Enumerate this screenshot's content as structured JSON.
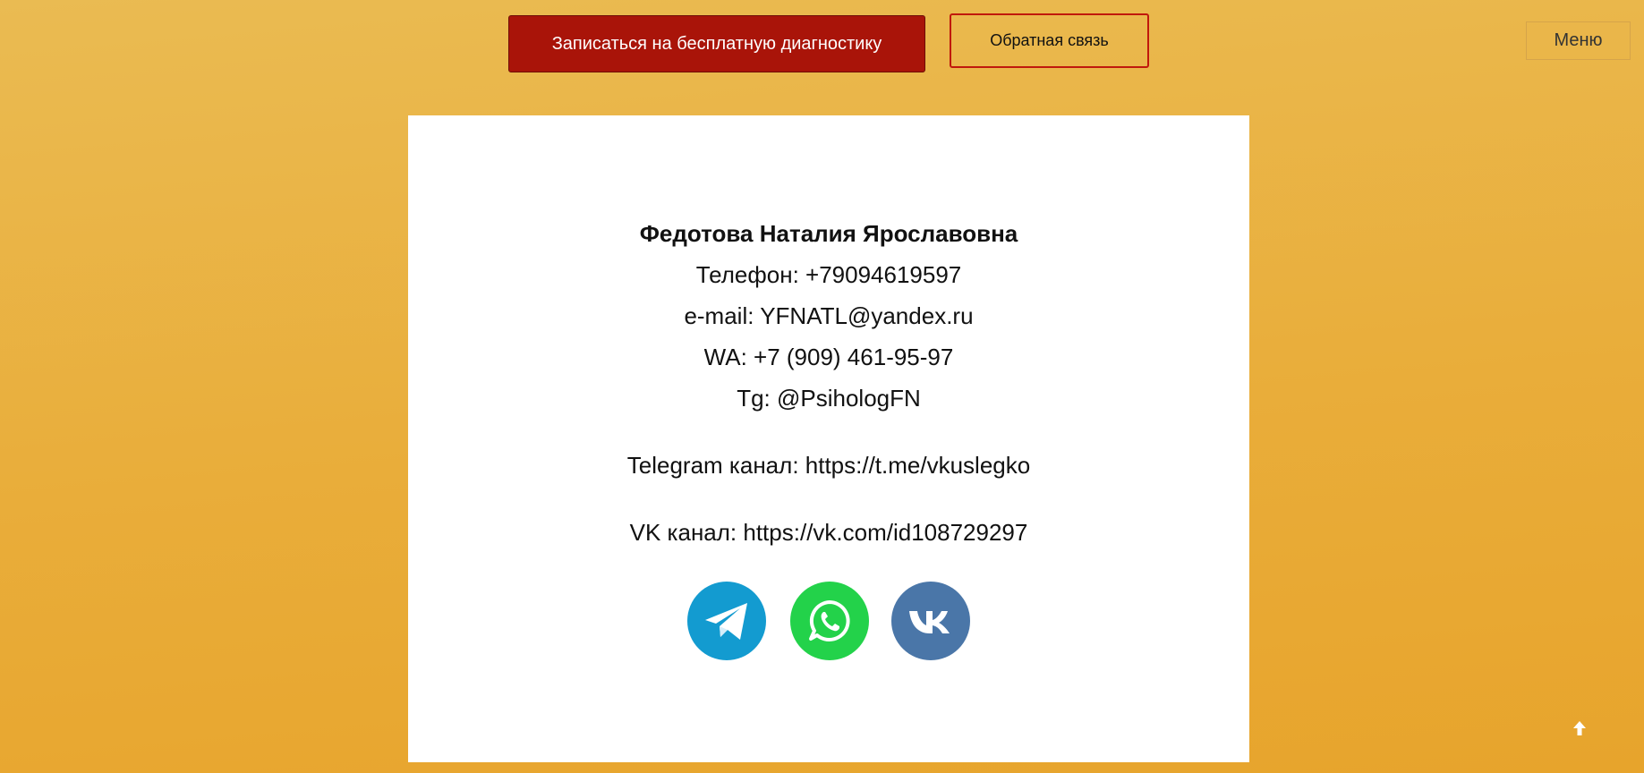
{
  "header": {
    "signup_button": "Записаться на бесплатную диагностику",
    "feedback_button": "Обратная связь",
    "menu_button": "Меню"
  },
  "contacts": {
    "name": "Федотова Наталия Ярославовна",
    "phone": "Телефон: +79094619597",
    "email": "e-mail: YFNATL@yandex.ru",
    "whatsapp": "WA: +7 (909) 461-95-97",
    "telegram": "Tg: @PsihologFN",
    "telegram_channel": "Telegram канал: https://t.me/vkuslegko",
    "vk_channel": "VK канал: https://vk.com/id108729297"
  },
  "social_icons": [
    "telegram-icon",
    "whatsapp-icon",
    "vk-icon"
  ],
  "colors": {
    "primary_button": "#a91409",
    "telegram": "#139bd0",
    "whatsapp": "#23d24a",
    "vk": "#4a76a8"
  }
}
